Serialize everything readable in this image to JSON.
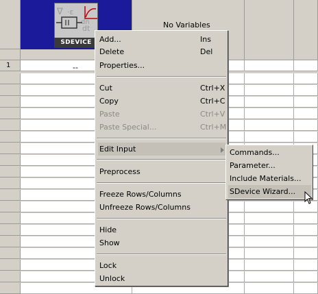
{
  "grid": {
    "tool_label": "SDEVICE",
    "variables_header": "No Variables",
    "row_numbers": [
      "1"
    ],
    "first_row_value": "--"
  },
  "menu": {
    "items": [
      {
        "label": "Add...",
        "shortcut": "Ins",
        "enabled": true
      },
      {
        "label": "Delete",
        "shortcut": "Del",
        "enabled": true
      },
      {
        "label": "Properties...",
        "shortcut": "",
        "enabled": true
      },
      {
        "label": "Cut",
        "shortcut": "Ctrl+X",
        "enabled": true
      },
      {
        "label": "Copy",
        "shortcut": "Ctrl+C",
        "enabled": true
      },
      {
        "label": "Paste",
        "shortcut": "Ctrl+V",
        "enabled": false
      },
      {
        "label": "Paste Special...",
        "shortcut": "Ctrl+M",
        "enabled": false
      },
      {
        "label": "Edit Input",
        "shortcut": "",
        "enabled": true,
        "submenu": true
      },
      {
        "label": "Preprocess",
        "shortcut": "",
        "enabled": true
      },
      {
        "label": "Freeze Rows/Columns",
        "shortcut": "",
        "enabled": true
      },
      {
        "label": "Unfreeze Rows/Columns",
        "shortcut": "",
        "enabled": true
      },
      {
        "label": "Hide",
        "shortcut": "",
        "enabled": true
      },
      {
        "label": "Show",
        "shortcut": "",
        "enabled": true
      },
      {
        "label": "Lock",
        "shortcut": "",
        "enabled": true
      },
      {
        "label": "Unlock",
        "shortcut": "",
        "enabled": true
      }
    ]
  },
  "submenu": {
    "items": [
      {
        "label": "Commands..."
      },
      {
        "label": "Parameter..."
      },
      {
        "label": "Include Materials..."
      },
      {
        "label": "SDevice Wizard..."
      }
    ]
  },
  "colors": {
    "header_bg": "#1a1a9a",
    "menu_bg": "#d4d0c8",
    "disabled_text": "#8c8a86"
  }
}
